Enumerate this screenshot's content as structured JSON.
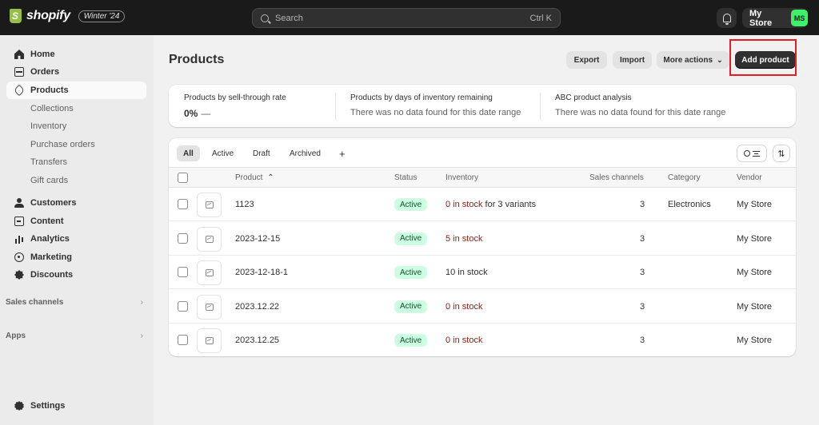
{
  "topbar": {
    "brand": "shopify",
    "edition_badge": "Winter '24",
    "search_placeholder": "Search",
    "search_shortcut": "Ctrl K",
    "store_name": "My Store",
    "avatar_initials": "MS"
  },
  "sidebar": {
    "items": [
      {
        "label": "Home",
        "icon": "home-icon"
      },
      {
        "label": "Orders",
        "icon": "orders-icon"
      },
      {
        "label": "Products",
        "icon": "products-icon"
      }
    ],
    "product_subitems": [
      "Collections",
      "Inventory",
      "Purchase orders",
      "Transfers",
      "Gift cards"
    ],
    "items2": [
      {
        "label": "Customers",
        "icon": "customers-icon"
      },
      {
        "label": "Content",
        "icon": "content-icon"
      },
      {
        "label": "Analytics",
        "icon": "analytics-icon"
      },
      {
        "label": "Marketing",
        "icon": "marketing-icon"
      },
      {
        "label": "Discounts",
        "icon": "discounts-icon"
      }
    ],
    "sales_channels_label": "Sales channels",
    "apps_label": "Apps",
    "settings_label": "Settings"
  },
  "page": {
    "title": "Products",
    "actions": {
      "export": "Export",
      "import": "Import",
      "more_actions": "More actions",
      "add_product": "Add product"
    }
  },
  "metrics": [
    {
      "label": "Products by sell-through rate",
      "value": "0%",
      "trend": "—"
    },
    {
      "label": "Products by days of inventory remaining",
      "empty": "There was no data found for this date range"
    },
    {
      "label": "ABC product analysis",
      "empty": "There was no data found for this date range"
    }
  ],
  "filters": {
    "tabs": [
      "All",
      "Active",
      "Draft",
      "Archived"
    ],
    "add": "+",
    "active_tab": "All"
  },
  "table": {
    "columns": {
      "product": "Product",
      "product_sort": "⌃",
      "status": "Status",
      "inventory": "Inventory",
      "sales_channels": "Sales channels",
      "category": "Category",
      "vendor": "Vendor"
    },
    "rows": [
      {
        "product": "1123",
        "status": "Active",
        "stock": "0 in stock",
        "stock_suffix": " for 3 variants",
        "stock_low": true,
        "channels": "3",
        "category": "Electronics",
        "vendor": "My Store"
      },
      {
        "product": "2023-12-15",
        "status": "Active",
        "stock": "5 in stock",
        "stock_suffix": "",
        "stock_low": true,
        "channels": "3",
        "category": "",
        "vendor": "My Store"
      },
      {
        "product": "2023-12-18-1",
        "status": "Active",
        "stock": "10 in stock",
        "stock_suffix": "",
        "stock_low": false,
        "channels": "3",
        "category": "",
        "vendor": "My Store"
      },
      {
        "product": "2023.12.22",
        "status": "Active",
        "stock": "0 in stock",
        "stock_suffix": "",
        "stock_low": true,
        "channels": "3",
        "category": "",
        "vendor": "My Store"
      },
      {
        "product": "2023.12.25",
        "status": "Active",
        "stock": "0 in stock",
        "stock_suffix": "",
        "stock_low": true,
        "channels": "3",
        "category": "",
        "vendor": "My Store"
      }
    ]
  },
  "colors": {
    "topbar": "#1a1a1a",
    "primary_button": "#303030",
    "active_badge_bg": "#cdfee1",
    "low_stock_text": "#8e1f0b",
    "highlight_box": "#e51c23",
    "avatar": "#3df26a"
  }
}
